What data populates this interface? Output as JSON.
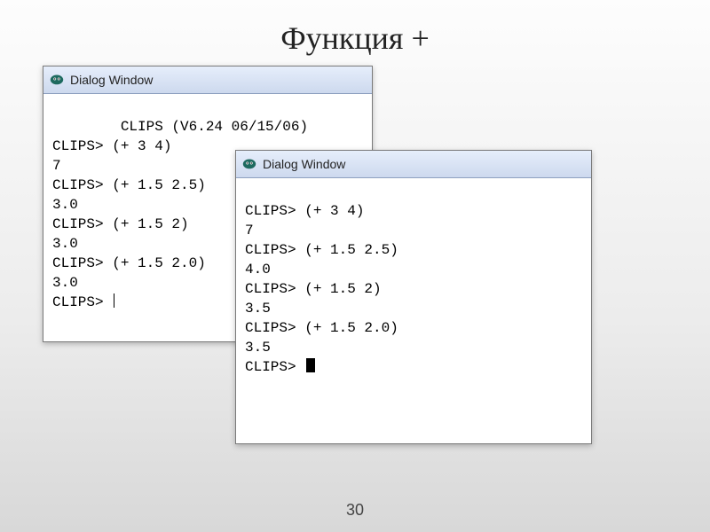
{
  "slide": {
    "title": "Функция +",
    "page_number": "30"
  },
  "window1": {
    "title": "Dialog Window",
    "header": "        CLIPS (V6.24 06/15/06)",
    "lines": [
      "CLIPS> (+ 3 4)",
      "7",
      "CLIPS> (+ 1.5 2.5)",
      "3.0",
      "CLIPS> (+ 1.5 2)",
      "3.0",
      "CLIPS> (+ 1.5 2.0)",
      "3.0",
      "CLIPS> "
    ]
  },
  "window2": {
    "title": "Dialog Window",
    "lines": [
      "CLIPS> (+ 3 4)",
      "7",
      "CLIPS> (+ 1.5 2.5)",
      "4.0",
      "CLIPS> (+ 1.5 2)",
      "3.5",
      "CLIPS> (+ 1.5 2.0)",
      "3.5",
      "CLIPS> "
    ]
  }
}
